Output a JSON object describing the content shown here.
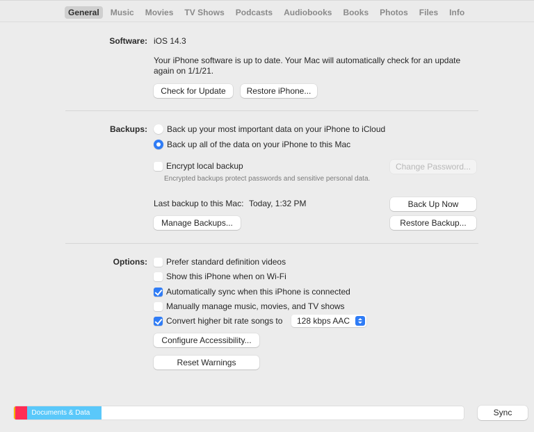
{
  "tabs": [
    {
      "label": "General",
      "active": true
    },
    {
      "label": "Music",
      "active": false
    },
    {
      "label": "Movies",
      "active": false
    },
    {
      "label": "TV Shows",
      "active": false
    },
    {
      "label": "Podcasts",
      "active": false
    },
    {
      "label": "Audiobooks",
      "active": false
    },
    {
      "label": "Books",
      "active": false
    },
    {
      "label": "Photos",
      "active": false
    },
    {
      "label": "Files",
      "active": false
    },
    {
      "label": "Info",
      "active": false
    }
  ],
  "software": {
    "label": "Software:",
    "version": "iOS 14.3",
    "status_line1": "Your iPhone software is up to date. Your Mac will automatically check for an update",
    "status_line2": "again on 1/1/21.",
    "check_update_label": "Check for Update",
    "restore_iphone_label": "Restore iPhone..."
  },
  "backups": {
    "label": "Backups:",
    "options": [
      {
        "label": "Back up your most important data on your iPhone to iCloud",
        "selected": false
      },
      {
        "label": "Back up all of the data on your iPhone to this Mac",
        "selected": true
      }
    ],
    "encrypt_label": "Encrypt local backup",
    "encrypt_checked": false,
    "encrypt_note": "Encrypted backups protect passwords and sensitive personal data.",
    "change_password_label": "Change Password...",
    "last_backup_label": "Last backup to this Mac:",
    "last_backup_value": "Today, 1:32 PM",
    "back_up_now_label": "Back Up Now",
    "manage_backups_label": "Manage Backups...",
    "restore_backup_label": "Restore Backup..."
  },
  "options": {
    "label": "Options:",
    "items": [
      {
        "label": "Prefer standard definition videos",
        "checked": false
      },
      {
        "label": "Show this iPhone when on Wi-Fi",
        "checked": false
      },
      {
        "label": "Automatically sync when this iPhone is connected",
        "checked": true
      },
      {
        "label": "Manually manage music, movies, and TV shows",
        "checked": false
      },
      {
        "label": "Convert higher bit rate songs to",
        "checked": true
      }
    ],
    "bitrate_value": "128 kbps AAC",
    "configure_accessibility_label": "Configure Accessibility...",
    "reset_warnings_label": "Reset Warnings"
  },
  "storage": {
    "segments": [
      {
        "name": "apps-segment",
        "color": "#f5b800",
        "fraction": 0.003,
        "label": ""
      },
      {
        "name": "other-segment",
        "color": "#ff2d55",
        "fraction": 0.027,
        "label": ""
      },
      {
        "name": "documents-data-segment",
        "color": "#5ac8fa",
        "fraction": 0.165,
        "label": "Documents & Data"
      }
    ]
  },
  "sync_label": "Sync"
}
